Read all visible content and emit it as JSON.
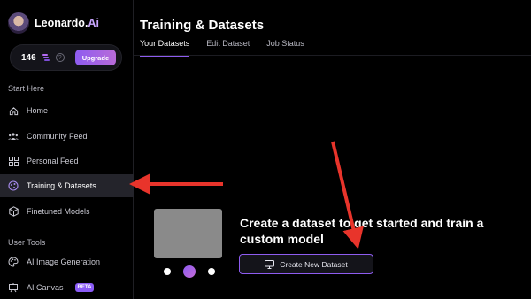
{
  "app": {
    "logo_name": "Leonardo.",
    "logo_suffix": "Ai"
  },
  "tokens": {
    "count": "146",
    "upgrade_label": "Upgrade",
    "help_symbol": "?"
  },
  "sidebar": {
    "start_here_label": "Start Here",
    "start_items": [
      {
        "label": "Home",
        "icon": "home-icon"
      },
      {
        "label": "Community Feed",
        "icon": "community-icon"
      },
      {
        "label": "Personal Feed",
        "icon": "grid-icon"
      },
      {
        "label": "Training & Datasets",
        "icon": "training-icon",
        "active": true
      },
      {
        "label": "Finetuned Models",
        "icon": "cube-icon"
      }
    ],
    "user_tools_label": "User Tools",
    "tool_items": [
      {
        "label": "AI Image Generation",
        "icon": "palette-icon"
      },
      {
        "label": "AI Canvas",
        "icon": "canvas-icon",
        "badge": "BETA"
      }
    ]
  },
  "main": {
    "title": "Training & Datasets",
    "tabs": [
      {
        "label": "Your Datasets",
        "active": true
      },
      {
        "label": "Edit Dataset"
      },
      {
        "label": "Job Status"
      }
    ],
    "cta_title": "Create a dataset to get started and train a custom model",
    "create_button_label": "Create New Dataset",
    "carousel": {
      "count": 3,
      "active_index": 1
    }
  },
  "colors": {
    "accent": "#8e5cf0",
    "annotation_arrow": "#e8342b"
  }
}
